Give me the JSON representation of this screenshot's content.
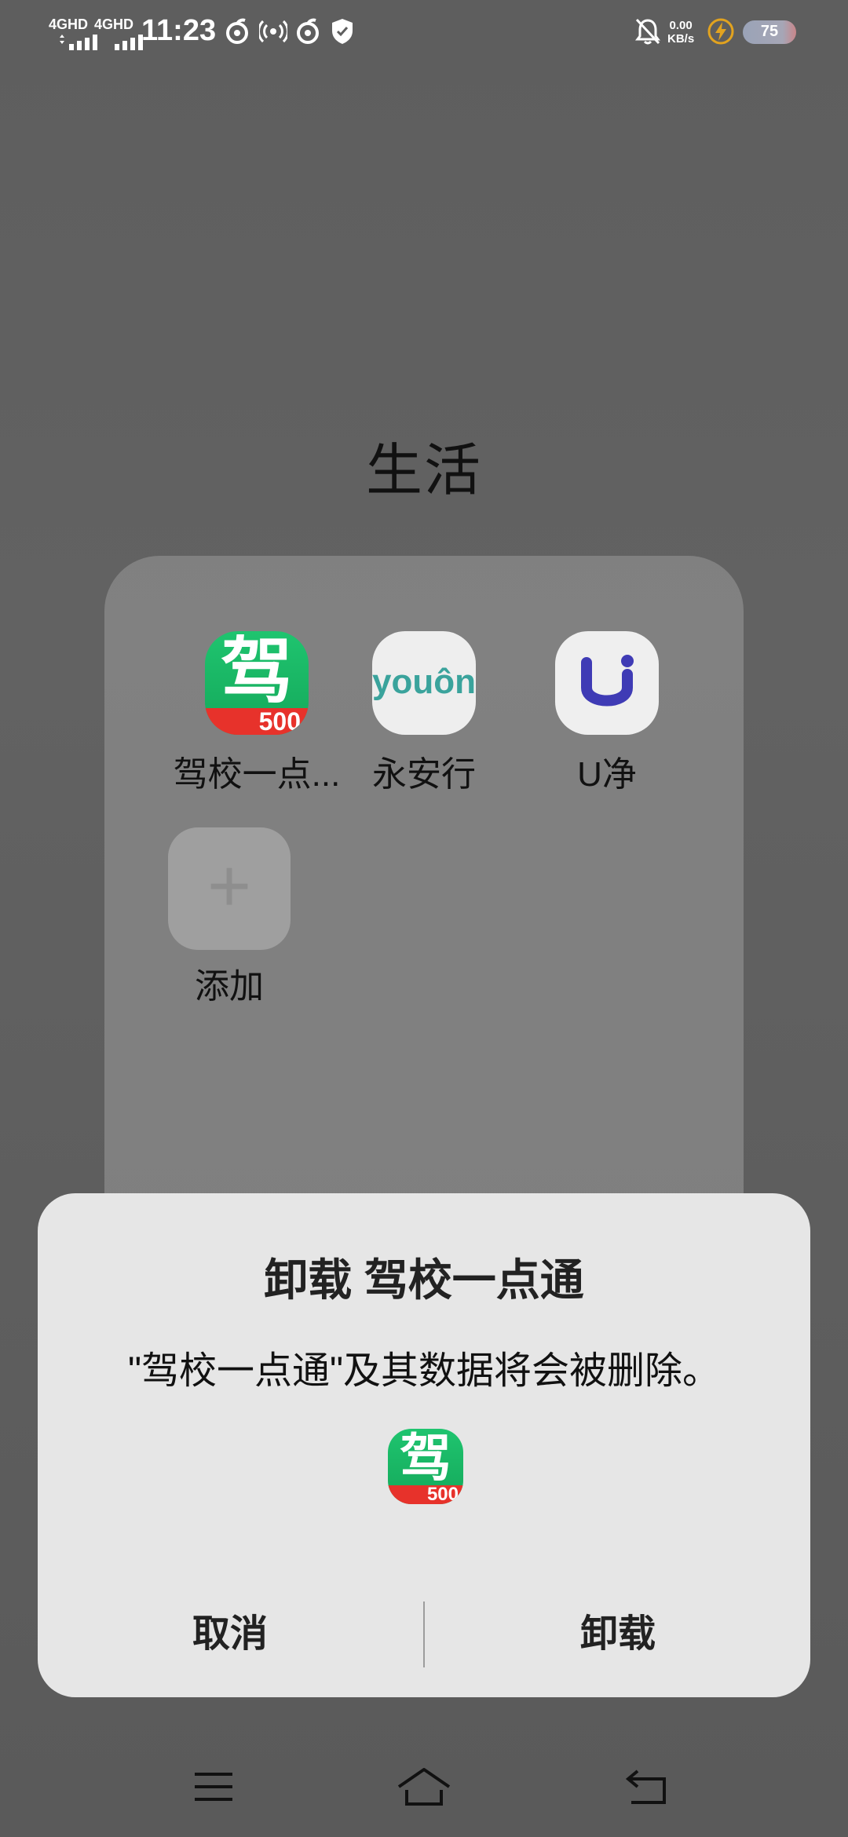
{
  "status_bar": {
    "network1": "4GHD",
    "network2": "4GHD",
    "time": "11:23",
    "speed_value": "0.00",
    "speed_unit": "KB/s",
    "battery": "75"
  },
  "folder": {
    "title": "生活",
    "apps": [
      {
        "label": "驾校一点...",
        "icon_char": "驾",
        "badge": "500"
      },
      {
        "label": "永安行",
        "icon_text": "youôn"
      },
      {
        "label": "U净"
      }
    ],
    "add_label": "添加"
  },
  "dialog": {
    "title": "卸载 驾校一点通",
    "message": "\"驾校一点通\"及其数据将会被删除。",
    "icon_char": "驾",
    "icon_badge": "500",
    "cancel": "取消",
    "confirm": "卸载"
  },
  "colors": {
    "jx_green": "#1fc46f",
    "badge_red": "#e7322b",
    "youon_teal": "#3aa39c",
    "ujing_purple": "#3f3bb5"
  }
}
